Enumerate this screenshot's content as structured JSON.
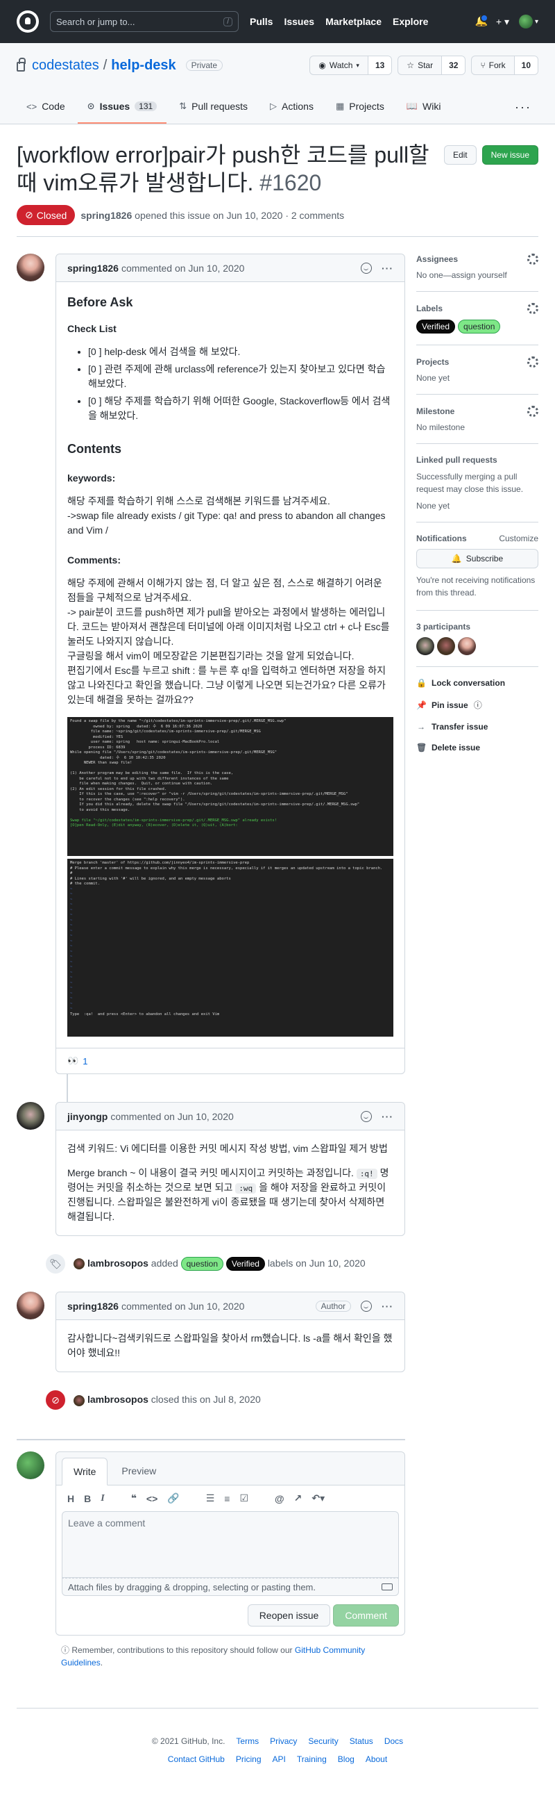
{
  "header": {
    "search_placeholder": "Search or jump to...",
    "slash_key": "/",
    "nav": [
      "Pulls",
      "Issues",
      "Marketplace",
      "Explore"
    ],
    "plus": "+ ▾",
    "avatar_caret": "▾"
  },
  "repo": {
    "owner": "codestates",
    "separator": "/",
    "name": "help-desk",
    "visibility": "Private",
    "watch_label": "Watch",
    "watch_count": "13",
    "star_label": "Star",
    "star_count": "32",
    "fork_label": "Fork",
    "fork_count": "10",
    "tabs": [
      {
        "label": "Code",
        "icon": "<>"
      },
      {
        "label": "Issues",
        "icon": "⊙",
        "count": "131"
      },
      {
        "label": "Pull requests",
        "icon": "⇅"
      },
      {
        "label": "Actions",
        "icon": "▷"
      },
      {
        "label": "Projects",
        "icon": "▦"
      },
      {
        "label": "Wiki",
        "icon": "📖"
      }
    ],
    "more": "···"
  },
  "issue": {
    "title": "[workflow error]pair가 push한 코드를 pull할때 vim오류가 발생합니다.",
    "number": "#1620",
    "edit_label": "Edit",
    "new_issue_label": "New issue",
    "state": "Closed",
    "author": "spring1826",
    "meta": "opened this issue on Jun 10, 2020 · 2 comments"
  },
  "comments": [
    {
      "author": "spring1826",
      "meta": "commented on Jun 10, 2020",
      "before_ask": "Before Ask",
      "check_list": "Check List",
      "checks": [
        "[0 ] help-desk 에서 검색을 해 보았다.",
        "[0 ] 관련 주제에 관해 urclass에 reference가 있는지 찾아보고 있다면 학습해보았다.",
        "[0 ] 해당 주제를 학습하기 위해 어떠한 Google, Stackoverflow등 에서 검색을 해보았다."
      ],
      "contents": "Contents",
      "keywords_label": "keywords:",
      "keywords_p1": "해당 주제를 학습하기 위해 스스로 검색해본 키워드를 남겨주세요.",
      "keywords_p2": "->swap file already exists / git Type: qa! and press to abandon all changes and Vim /",
      "comments_label": "Comments:",
      "comments_p1": "해당 주제에 관해서 이해가지 않는 점, 더 알고 싶은 점, 스스로 해결하기 어려운 점들을 구체적으로 남겨주세요.",
      "comments_p2": "-> pair분이 코드를 push하면 제가 pull을 받아오는 과정에서 발생하는 에러입니다. 코드는 받아져서 괜찮은데 터미널에 아래 이미지처럼 나오고 ctrl + c나 Esc를 눌러도 나와지지 않습니다.",
      "comments_p3": "구글링을 해서 vim이 메모장같은 기본편집기라는 것을 알게 되었습니다.",
      "comments_p4": "편집기에서 Esc를 누르고 shift : 를 누른 후 q!을 입력하고 엔터하면 저장을 하지 않고 나와진다고 확인을 했습니다. 그냥 이렇게 나오면 되는건가요? 다른 오류가 있는데 해결을 못하는 걸까요??",
      "reaction_emoji": "👀",
      "reaction_count": "1"
    },
    {
      "author": "jinyongp",
      "meta": "commented on Jun 10, 2020",
      "p1": "검색 키워드: Vi 에디터를 이용한 커밋 메시지 작성 방법, vim 스왑파일 제거 방법",
      "p2_a": "Merge branch ~ 이 내용이 결국 커밋 메시지이고 커밋하는 과정입니다.",
      "code1": ":q!",
      "p2_b": "명령어는 커밋을 취소하는 것으로 보면 되고",
      "code2": ":wq",
      "p2_c": "을 해야 저장을 완료하고 커밋이 진행됩니다. 스왑파일은 불완전하게 vi이 종료됐을 때 생기는데 찾아서 삭제하면 해결됩니다."
    },
    {
      "author": "spring1826",
      "meta": "commented on Jun 10, 2020",
      "badge": "Author",
      "body": "감사합니다~검색키워드로 스왑파일을 찾아서 rm했습니다. ls -a를 해서 확인을 했어야 했네요!!"
    }
  ],
  "events": {
    "label_actor": "lambrosopos",
    "label_action": "added",
    "label_suffix": "labels on Jun 10, 2020",
    "close_actor": "lambrosopos",
    "close_text": "closed this on Jul 8, 2020"
  },
  "labels": {
    "question": "question",
    "verified": "Verified"
  },
  "terminal1": [
    "Found a swap file by the name \"~/git/codestates/im-sprints-immersive-prep/.git/.MERGE_MSG.swp\"",
    "          owned by: spring   dated: 수  6 09 16:07:36 2020",
    "         file name: ~spring/git/codestates/im-sprints-immersive-prep/.git/MERGE_MSG",
    "          modified: YES",
    "         user name: spring   host name: springui-MacBookPro.local",
    "        process ID: 6839",
    "While opening file \"/Users/spring/git/codestates/im-sprints-immersive-prep/.git/MERGE_MSG\"",
    "             dated: 수  6 10 10:42:35 2020",
    "      NEWER than swap file!",
    "",
    "(1) Another program may be editing the same file.  If this is the case,",
    "    be careful not to end up with two different instances of the same",
    "    file when making changes.  Quit, or continue with caution.",
    "(2) An edit session for this file crashed.",
    "    If this is the case, use \":recover\" or \"vim -r /Users/spring/git/codestates/im-sprints-immersive-prep/.git/MERGE_MSG\"",
    "    to recover the changes (see \":help recovery\").",
    "    If you did this already, delete the swap file \"/Users/spring/git/codestates/im-sprints-immersive-prep/.git/.MERGE_MSG.swp\"",
    "    to avoid this message.",
    "",
    "Swap file \"~/git/codestates/im-sprints-immersive-prep/.git/.MERGE_MSG.swp\" already exists!",
    "[O]pen Read-Only, (E)dit anyway, (R)ecover, (D)elete it, (Q)uit, (A)bort:"
  ],
  "terminal2": [
    "Merge branch 'master' of https://github.com/jinnyeo4/im-sprints-immersive-prep",
    "# Please enter a commit message to explain why this merge is necessary, especially if it merges an updated upstream into a topic branch.",
    "#",
    "# Lines starting with '#' will be ignored, and an empty message aborts",
    "# the commit."
  ],
  "terminal2_footer": "Type  :qa!  and press <Enter> to abandon all changes and exit Vim",
  "sidebar": {
    "assignees": "Assignees",
    "assignees_value": "No one—assign yourself",
    "labels": "Labels",
    "projects": "Projects",
    "projects_value": "None yet",
    "milestone": "Milestone",
    "milestone_value": "No milestone",
    "linked": "Linked pull requests",
    "linked_desc": "Successfully merging a pull request may close this issue.",
    "linked_value": "None yet",
    "notifications": "Notifications",
    "customize": "Customize",
    "subscribe": "Subscribe",
    "notif_desc": "You're not receiving notifications from this thread.",
    "participants": "3 participants",
    "lock": "Lock conversation",
    "pin": "Pin issue",
    "transfer": "Transfer issue",
    "delete": "Delete issue"
  },
  "composer": {
    "write_tab": "Write",
    "preview_tab": "Preview",
    "placeholder": "Leave a comment",
    "attach": "Attach files by dragging & dropping, selecting or pasting them.",
    "reopen": "Reopen issue",
    "comment": "Comment",
    "guidelines_prefix": "Remember, contributions to this repository should follow our",
    "guidelines_link": "GitHub Community Guidelines",
    "guidelines_suffix": "."
  },
  "footer": {
    "copyright": "© 2021 GitHub, Inc.",
    "row1": [
      "Terms",
      "Privacy",
      "Security",
      "Status",
      "Docs"
    ],
    "row2": [
      "Contact GitHub",
      "Pricing",
      "API",
      "Training",
      "Blog",
      "About"
    ]
  }
}
